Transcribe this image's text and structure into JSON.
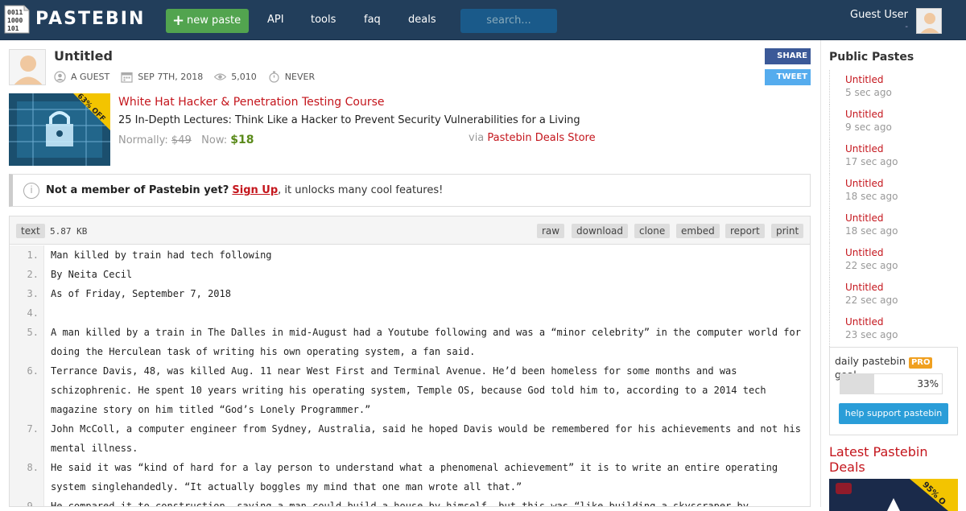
{
  "header": {
    "brand": "PASTEBIN",
    "new_paste": "new paste",
    "nav": [
      "API",
      "tools",
      "faq",
      "deals"
    ],
    "search_placeholder": "search...",
    "user_name": "Guest User",
    "user_sub": "-"
  },
  "paste": {
    "title": "Untitled",
    "author": "A GUEST",
    "date": "SEP 7TH, 2018",
    "views": "5,010",
    "expire": "NEVER",
    "share": "SHARE",
    "tweet": "TWEET"
  },
  "promo": {
    "badge": "63% OFF",
    "title": "White Hat Hacker & Penetration Testing Course",
    "subtitle": "25 In-Depth Lectures: Think Like a Hacker to Prevent Security Vulnerabilities for a Living",
    "normally_label": "Normally:",
    "normally_price": "$49",
    "now_label": "Now:",
    "now_price": "$18",
    "via_label": "via",
    "via_store": "Pastebin Deals Store"
  },
  "notice": {
    "bold": "Not a member of Pastebin yet?",
    "link": "Sign Up",
    "rest": ", it unlocks many cool features!"
  },
  "code": {
    "syntax": "text",
    "size": "5.87 KB",
    "actions": [
      "raw",
      "download",
      "clone",
      "embed",
      "report",
      "print"
    ],
    "lines": [
      {
        "n": "1.",
        "t": "Man killed by train had tech following"
      },
      {
        "n": "2.",
        "t": "By Neita Cecil"
      },
      {
        "n": "3.",
        "t": "As of Friday, September 7, 2018"
      },
      {
        "n": "4.",
        "t": ""
      },
      {
        "n": "5.",
        "t": "A man killed by a train in The Dalles in mid-August had a Youtube following and was a “minor celebrity” in the computer world for doing the Herculean task of writing his own operating system, a fan said."
      },
      {
        "n": "6.",
        "t": "Terrance Davis, 48, was killed Aug. 11 near West First and Terminal Avenue. He’d been homeless for some months and was schizophrenic. He spent 10 years writing his operating system, Temple OS, because God told him to, according to a 2014 tech magazine story on him titled “God’s Lonely Programmer.”"
      },
      {
        "n": "7.",
        "t": "John McColl, a computer engineer from Sydney, Australia, said he hoped Davis would be remembered for his achievements and not his mental illness."
      },
      {
        "n": "8.",
        "t": "He said it was “kind of hard for a lay person to understand what a phenomenal achievement” it is to write an entire operating system singlehandedly. “It actually boggles my mind that one man wrote all that.”"
      },
      {
        "n": "9.",
        "t": "He compared it to construction, saying a man could build a house by himself, but this was “like building a skyscraper by"
      }
    ]
  },
  "sidebar": {
    "heading": "Public Pastes",
    "items": [
      {
        "title": "Untitled",
        "age": "5 sec ago"
      },
      {
        "title": "Untitled",
        "age": "9 sec ago"
      },
      {
        "title": "Untitled",
        "age": "17 sec ago"
      },
      {
        "title": "Untitled",
        "age": "18 sec ago"
      },
      {
        "title": "Untitled",
        "age": "18 sec ago"
      },
      {
        "title": "Untitled",
        "age": "22 sec ago"
      },
      {
        "title": "Untitled",
        "age": "22 sec ago"
      },
      {
        "title": "Untitled",
        "age": "23 sec ago"
      }
    ],
    "goal_prefix": "daily pastebin",
    "goal_pro": "PRO",
    "goal_suffix": "goal",
    "goal_percent": 33,
    "goal_label": "33%",
    "support": "help support pastebin",
    "deals_heading": "Latest Pastebin Deals",
    "deal_badge": "95% O"
  },
  "colors": {
    "topbar": "#223e5b",
    "accent_red": "#c4151c",
    "new_paste_green": "#52a44f",
    "price_green": "#5a8a1a",
    "share_blue": "#3b5998",
    "tweet_blue": "#55acee"
  }
}
